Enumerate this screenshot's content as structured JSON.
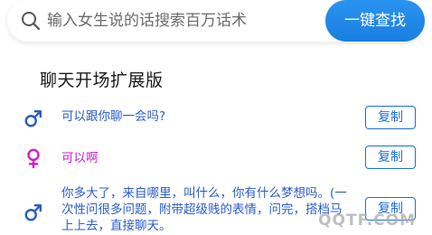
{
  "search": {
    "placeholder": "输入女生说的话搜索百万话术",
    "button_label": "一键查找"
  },
  "section": {
    "title": "聊天开场扩展版"
  },
  "rows": [
    {
      "gender": "male",
      "icon": "male-icon",
      "text": "可以跟你聊一会吗?",
      "copy_label": "复制"
    },
    {
      "gender": "female",
      "icon": "female-icon",
      "text": "可以啊",
      "copy_label": "复制"
    },
    {
      "gender": "male",
      "icon": "male-icon",
      "text": "你多大了，来自哪里，叫什么，你有什么梦想吗。(一次性问很多问题，附带超级贱的表情，问完，搭档马上上去，直接聊天。",
      "copy_label": "复制"
    }
  ],
  "watermark": "QQTF.COM",
  "colors": {
    "accent": "#1a7fe0",
    "male": "#2a5cc8",
    "female": "#cc1fcc"
  }
}
